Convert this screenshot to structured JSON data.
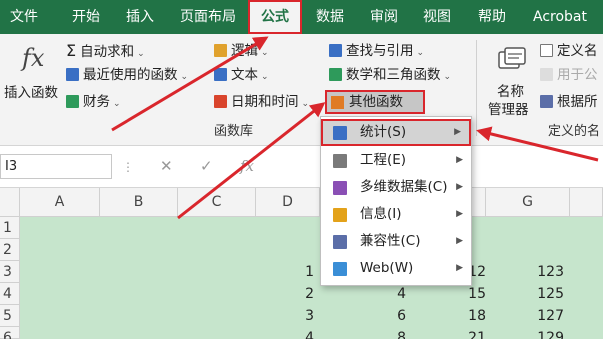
{
  "ribbon_tabs": [
    {
      "label": "文件"
    },
    {
      "label": "开始"
    },
    {
      "label": "插入"
    },
    {
      "label": "页面布局"
    },
    {
      "label": "公式"
    },
    {
      "label": "数据"
    },
    {
      "label": "审阅"
    },
    {
      "label": "视图"
    },
    {
      "label": "帮助"
    },
    {
      "label": "Acrobat"
    }
  ],
  "function_library": {
    "insert_function": "插入函数",
    "fx_symbol": "fx",
    "autosum": "自动求和",
    "recent": "最近使用的函数",
    "financial": "财务",
    "logical": "逻辑",
    "text": "文本",
    "datetime": "日期和时间",
    "lookup": "查找与引用",
    "math": "数学和三角函数",
    "other": "其他函数",
    "group_label": "函数库"
  },
  "defined_names": {
    "name_manager_1": "名称",
    "name_manager_2": "管理器",
    "define_name": "定义名",
    "use_in_formula": "用于公",
    "create_from_selection": "根据所",
    "group_label": "定义的名"
  },
  "formula_bar": {
    "name_box": "I3",
    "cancel": "✕",
    "enter": "✓",
    "fx": "fx"
  },
  "columns": [
    "A",
    "B",
    "C",
    "D",
    "G"
  ],
  "rows": [
    "1",
    "2",
    "3",
    "4",
    "5",
    "6"
  ],
  "cells": [
    {
      "col": "D",
      "row": "3",
      "value": "1"
    },
    {
      "col": "D",
      "row": "4",
      "value": "2"
    },
    {
      "col": "D",
      "row": "5",
      "value": "3"
    },
    {
      "col": "D",
      "row": "6",
      "value": "4"
    },
    {
      "col": "E",
      "row": "3",
      "value": "2"
    },
    {
      "col": "E",
      "row": "4",
      "value": "4"
    },
    {
      "col": "E",
      "row": "5",
      "value": "6"
    },
    {
      "col": "E",
      "row": "6",
      "value": "8"
    },
    {
      "col": "F",
      "row": "3",
      "value": "12"
    },
    {
      "col": "F",
      "row": "4",
      "value": "15"
    },
    {
      "col": "F",
      "row": "5",
      "value": "18"
    },
    {
      "col": "F",
      "row": "6",
      "value": "21"
    },
    {
      "col": "G",
      "row": "3",
      "value": "123"
    },
    {
      "col": "G",
      "row": "4",
      "value": "125"
    },
    {
      "col": "G",
      "row": "5",
      "value": "127"
    },
    {
      "col": "G",
      "row": "6",
      "value": "129"
    }
  ],
  "menu": [
    {
      "label": "统计(S)",
      "accel": "S",
      "highlighted": true,
      "icon": "stats-chart-icon",
      "color": "#3a6fc4"
    },
    {
      "label": "工程(E)",
      "accel": "E",
      "icon": "engineering-icon",
      "color": "#7a7a7a"
    },
    {
      "label": "多维数据集(C)",
      "accel": "C",
      "icon": "cube-icon",
      "color": "#8a4fb5"
    },
    {
      "label": "信息(I)",
      "accel": "I",
      "icon": "info-icon",
      "color": "#e3a21a"
    },
    {
      "label": "兼容性(C)",
      "accel": "C",
      "icon": "compat-icon",
      "color": "#5b6ea8"
    },
    {
      "label": "Web(W)",
      "accel": "W",
      "icon": "web-icon",
      "color": "#3a8ed6"
    }
  ],
  "colors": {
    "brand": "#217346",
    "annotation": "#d9262c",
    "selection_fill": "#c6e5cc"
  }
}
